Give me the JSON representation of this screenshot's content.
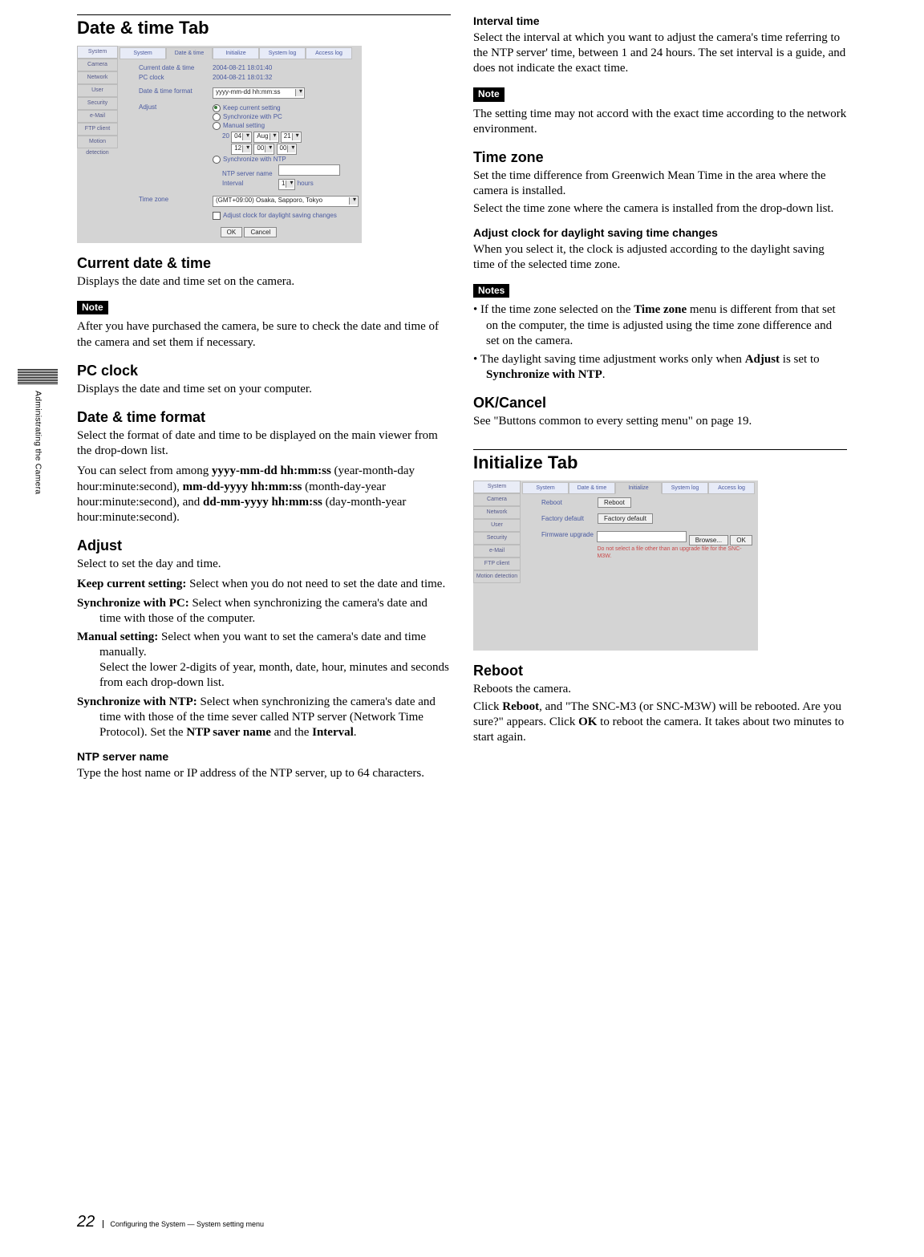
{
  "page_number": "22",
  "footer_text": "Configuring the System — System setting menu",
  "side_text": "Administrating the Camera",
  "left": {
    "title": "Date & time Tab",
    "shot": {
      "side": [
        "System",
        "Camera",
        "Network",
        "User",
        "Security",
        "e-Mail",
        "FTP client",
        "Motion detection"
      ],
      "tabs": [
        "System",
        "Date & time",
        "Initialize",
        "System log",
        "Access log"
      ],
      "active_tab": "Date & time",
      "current_label": "Current date & time",
      "current_val": "2004-08-21  18:01:40",
      "pc_label": "PC clock",
      "pc_val": "2004-08-21  18:01:32",
      "fmt_label": "Date & time format",
      "fmt_val": "yyyy-mm-dd hh:mm:ss",
      "adjust_label": "Adjust",
      "r1": "Keep current setting",
      "r2": "Synchronize with PC",
      "r3": "Manual setting",
      "m_year_pre": "20",
      "m_year": "04",
      "m_mon": "Aug",
      "m_day": "21",
      "m_h": "12",
      "m_mi": "00",
      "m_s": "00",
      "r4": "Synchronize with NTP",
      "ntp_label": "NTP server name",
      "int_label": "Interval",
      "int_val": "1",
      "int_unit": "hours",
      "tz_label": "Time zone",
      "tz_val": "(GMT+09:00) Osaka, Sapporo, Tokyo",
      "dst": "Adjust clock for daylight saving changes",
      "ok": "OK",
      "cancel": "Cancel"
    },
    "s1_h": "Current date & time",
    "s1_p": "Displays the date and time set on the camera.",
    "note1": "Note",
    "s1_note": "After you have purchased the camera, be sure to check the date and time of the camera and set them if necessary.",
    "s2_h": "PC clock",
    "s2_p": "Displays the date and time set on your computer.",
    "s3_h": "Date & time format",
    "s3_p1": "Select the format of date and time to be displayed on the main viewer from the drop-down list.",
    "s3_p2a": "You can select from among ",
    "s3_b1": "yyyy-mm-dd hh:mm:ss",
    "s3_p2b": " (year-month-day hour:minute:second), ",
    "s3_b2": "mm-dd-yyyy hh:mm:ss",
    "s3_p2c": " (month-day-year hour:minute:second), and ",
    "s3_b3": "dd-mm-yyyy hh:mm:ss",
    "s3_p2d": " (day-month-year hour:minute:second).",
    "s4_h": "Adjust",
    "s4_p": "Select to set the day and time.",
    "d1b": "Keep current setting:",
    "d1": " Select when you do not need to set the date and time.",
    "d2b": "Synchronize with PC:",
    "d2": " Select when synchronizing the camera's date and time with those of the computer.",
    "d3b": "Manual setting:",
    "d3a": " Select when you want to set the camera's date and time manually.",
    "d3c": "Select the lower 2-digits of year, month, date, hour, minutes and seconds from each drop-down list.",
    "d4b": "Synchronize with NTP:",
    "d4a": " Select when synchronizing the camera's date and time with those of the time sever called NTP server (Network Time Protocol). Set the ",
    "d4b2": "NTP saver name",
    "d4c": " and the ",
    "d4b3": "Interval",
    "d4d": ".",
    "s5_h": "NTP server name",
    "s5_p": "Type the host name or IP address of the NTP server, up to 64 characters."
  },
  "right": {
    "s6_h": "Interval time",
    "s6_p": "Select the interval at which you want to adjust the camera's time referring to the NTP server' time, between 1 and 24 hours.  The set interval is a guide, and does not indicate the exact time.",
    "note2": "Note",
    "s6_note": "The setting time may not accord with the exact time according to the network environment.",
    "s7_h": "Time zone",
    "s7_p1": "Set the time difference from Greenwich Mean Time in the area where the camera is installed.",
    "s7_p2": "Select the time zone where the camera is installed from the drop-down list.",
    "s8_h": "Adjust clock for daylight saving time changes",
    "s8_p": "When you select it, the clock is adjusted according to the daylight saving time of the selected time zone.",
    "notes": "Notes",
    "li1a": "If the time zone selected on the ",
    "li1b": "Time zone",
    "li1c": " menu is different from that set on the computer, the time is adjusted using the time zone difference and set on the camera.",
    "li2a": "The daylight saving time adjustment works only when ",
    "li2b": "Adjust",
    "li2c": " is set to ",
    "li2d": "Synchronize with NTP",
    "li2e": ".",
    "s9_h": "OK/Cancel",
    "s9_p": "See \"Buttons common to every setting menu\" on page 19.",
    "title2": "Initialize Tab",
    "shot": {
      "side": [
        "System",
        "Camera",
        "Network",
        "User",
        "Security",
        "e-Mail",
        "FTP client",
        "Motion detection"
      ],
      "tabs": [
        "System",
        "Date & time",
        "Initialize",
        "System log",
        "Access log"
      ],
      "active_tab": "Initialize",
      "rb_label": "Reboot",
      "rb_btn": "Reboot",
      "fd_label": "Factory default",
      "fd_btn": "Factory default",
      "fw_label": "Firmware upgrade",
      "browse": "Browse...",
      "ok": "OK",
      "fw_note": "Do not select a file other than an upgrade file for the SNC-M3W."
    },
    "s10_h": "Reboot",
    "s10_p1": "Reboots the camera.",
    "s10_p2a": "Click ",
    "s10_p2b": "Reboot",
    "s10_p2c": ", and \"The SNC-M3 (or SNC-M3W) will be rebooted.  Are you sure?\" appears.  Click ",
    "s10_p2d": "OK",
    "s10_p2e": " to reboot the camera.  It takes about two minutes to start again."
  }
}
